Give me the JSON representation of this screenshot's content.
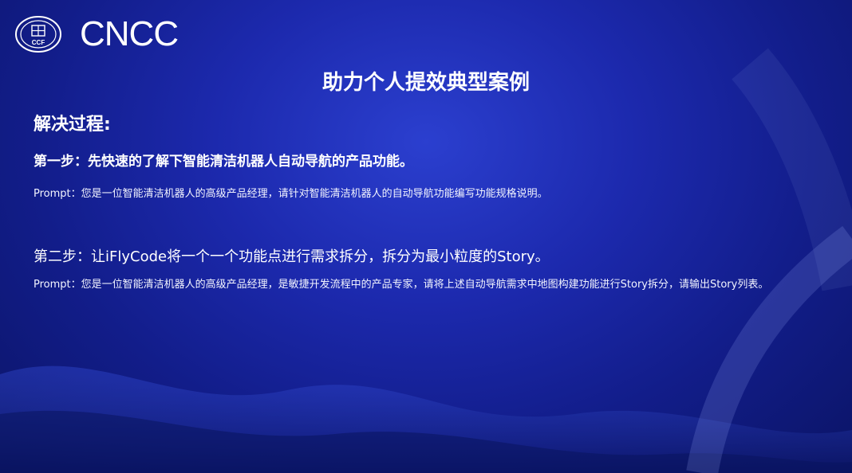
{
  "header": {
    "seal_text": "CCF",
    "logo_text": "CNCC"
  },
  "slide": {
    "title": "助力个人提效典型案例",
    "section_label": "解决过程:",
    "step1": {
      "heading": "第一步：先快速的了解下智能清洁机器人自动导航的产品功能。",
      "prompt": "Prompt：您是一位智能清洁机器人的高级产品经理，请针对智能清洁机器人的自动导航功能编写功能规格说明。"
    },
    "step2": {
      "heading": "第二步：让iFlyCode将一个一个功能点进行需求拆分，拆分为最小粒度的Story。",
      "prompt": "Prompt：您是一位智能清洁机器人的高级产品经理，是敏捷开发流程中的产品专家，请将上述自动导航需求中地图构建功能进行Story拆分，请输出Story列表。"
    }
  },
  "colors": {
    "background_center": "#2b3fcf",
    "background_edge": "#0b1466",
    "text": "#ffffff"
  }
}
